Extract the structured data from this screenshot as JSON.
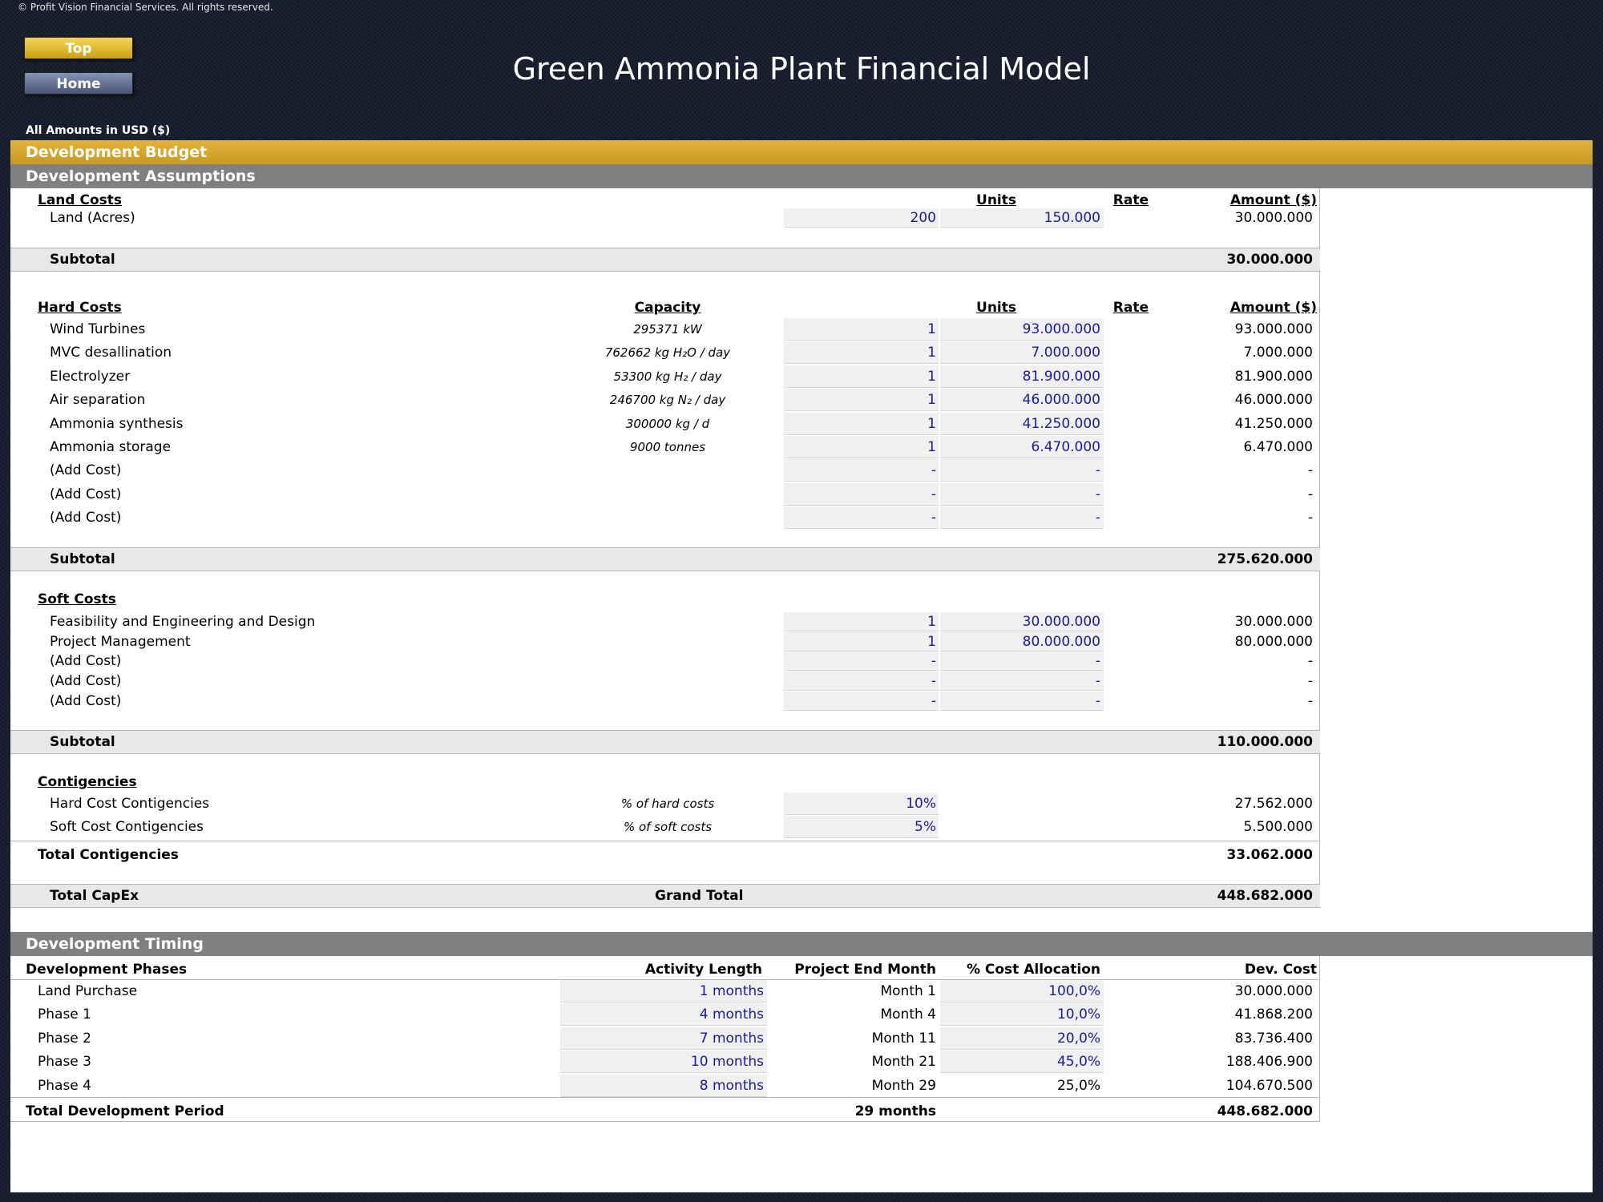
{
  "copyright": "© Profit Vision Financial Services. All rights reserved.",
  "nav": {
    "top_label": "Top",
    "home_label": "Home"
  },
  "title": "Green Ammonia Plant Financial Model",
  "amounts_note": "All Amounts in  USD ($)",
  "bands": {
    "budget": "Development Budget",
    "assumptions": "Development Assumptions",
    "timing": "Development Timing"
  },
  "land": {
    "heading": "Land Costs",
    "col_units": "Units",
    "col_rate": "Rate",
    "col_amount": "Amount ($)",
    "rows": [
      {
        "label": "Land (Acres)",
        "units": "200",
        "rate": "150.000",
        "amount": "30.000.000"
      }
    ],
    "subtotal_label": "Subtotal",
    "subtotal": "30.000.000"
  },
  "hard": {
    "heading": "Hard Costs",
    "col_capacity": "Capacity",
    "col_units": "Units",
    "col_rate": "Rate",
    "col_amount": "Amount ($)",
    "rows": [
      {
        "label": "Wind Turbines",
        "capacity": "295371 kW",
        "units": "1",
        "rate": "93.000.000",
        "amount": "93.000.000"
      },
      {
        "label": "MVC desallination",
        "capacity": "762662 kg H₂O / day",
        "units": "1",
        "rate": "7.000.000",
        "amount": "7.000.000"
      },
      {
        "label": "Electrolyzer",
        "capacity": "53300 kg H₂ / day",
        "units": "1",
        "rate": "81.900.000",
        "amount": "81.900.000"
      },
      {
        "label": "Air separation",
        "capacity": "246700 kg N₂ / day",
        "units": "1",
        "rate": "46.000.000",
        "amount": "46.000.000"
      },
      {
        "label": "Ammonia synthesis",
        "capacity": "300000 kg / d",
        "units": "1",
        "rate": "41.250.000",
        "amount": "41.250.000"
      },
      {
        "label": "Ammonia storage",
        "capacity": "9000 tonnes",
        "units": "1",
        "rate": "6.470.000",
        "amount": "6.470.000"
      },
      {
        "label": "(Add Cost)",
        "capacity": "",
        "units": "-",
        "rate": "-",
        "amount": "-"
      },
      {
        "label": "(Add Cost)",
        "capacity": "",
        "units": "-",
        "rate": "-",
        "amount": "-"
      },
      {
        "label": "(Add Cost)",
        "capacity": "",
        "units": "-",
        "rate": "-",
        "amount": "-"
      }
    ],
    "subtotal_label": "Subtotal",
    "subtotal": "275.620.000"
  },
  "soft": {
    "heading": "Soft Costs",
    "rows": [
      {
        "label": "Feasibility and Engineering and Design",
        "units": "1",
        "rate": "30.000.000",
        "amount": "30.000.000"
      },
      {
        "label": "Project Management",
        "units": "1",
        "rate": "80.000.000",
        "amount": "80.000.000"
      },
      {
        "label": "(Add Cost)",
        "units": "-",
        "rate": "-",
        "amount": "-"
      },
      {
        "label": "(Add Cost)",
        "units": "-",
        "rate": "-",
        "amount": "-"
      },
      {
        "label": "(Add Cost)",
        "units": "-",
        "rate": "-",
        "amount": "-"
      }
    ],
    "subtotal_label": "Subtotal",
    "subtotal": "110.000.000"
  },
  "contingencies": {
    "heading": "Contigencies",
    "rows": [
      {
        "label": "Hard Cost Contigencies",
        "basis": "% of hard costs",
        "pct": "10%",
        "amount": "27.562.000"
      },
      {
        "label": "Soft Cost Contigencies",
        "basis": "% of soft costs",
        "pct": "5%",
        "amount": "5.500.000"
      }
    ],
    "total_label": "Total Contigencies",
    "total": "33.062.000"
  },
  "capex": {
    "label": "Total CapEx",
    "grand_label": "Grand Total",
    "total": "448.682.000"
  },
  "timing": {
    "col_phases": "Development Phases",
    "col_length": "Activity Length",
    "col_end": "Project End Month",
    "col_alloc": "% Cost Allocation",
    "col_cost": "Dev. Cost",
    "rows": [
      {
        "label": "Land Purchase",
        "length": "1 months",
        "end": "Month 1",
        "alloc": "100,0%",
        "cost": "30.000.000"
      },
      {
        "label": "Phase 1",
        "length": "4 months",
        "end": "Month 4",
        "alloc": "10,0%",
        "cost": "41.868.200"
      },
      {
        "label": "Phase 2",
        "length": "7 months",
        "end": "Month 11",
        "alloc": "20,0%",
        "cost": "83.736.400"
      },
      {
        "label": "Phase 3",
        "length": "10 months",
        "end": "Month 21",
        "alloc": "45,0%",
        "cost": "188.406.900"
      },
      {
        "label": "Phase 4",
        "length": "8 months",
        "end": "Month 29",
        "alloc": "25,0%",
        "cost": "104.670.500"
      }
    ],
    "total_label": "Total Development Period",
    "total_months": "29 months",
    "total_cost": "448.682.000"
  }
}
